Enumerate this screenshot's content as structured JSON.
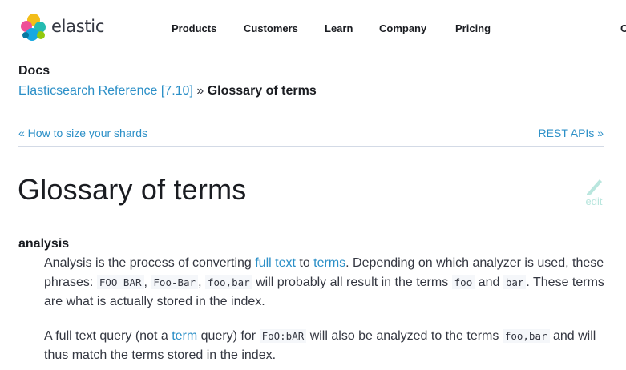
{
  "header": {
    "logo_text": "elastic",
    "nav": [
      "Products",
      "Customers",
      "Learn",
      "Company",
      "Pricing",
      "C"
    ]
  },
  "docs_label": "Docs",
  "breadcrumb": {
    "parent": "Elasticsearch Reference [7.10]",
    "separator": "»",
    "current": "Glossary of terms"
  },
  "pager": {
    "prev": "« How to size your shards",
    "next": "REST APIs »"
  },
  "page_title": "Glossary of terms",
  "edit_label": "edit",
  "term": {
    "name": "analysis",
    "p1": {
      "t1": "Analysis is the process of converting ",
      "link1": "full text",
      "t2": " to ",
      "link2": "terms",
      "t3": ". Depending on which analyzer is used, these phrases: ",
      "c1": "FOO BAR",
      "t4": ", ",
      "c2": "Foo-Bar",
      "t5": ", ",
      "c3": "foo,bar",
      "t6": " will probably all result in the terms ",
      "c4": "foo",
      "t7": " and ",
      "c5": "bar",
      "t8": ". These terms are what is actually stored in the index."
    },
    "p2": {
      "t1": "A full text query (not a ",
      "link1": "term",
      "t2": " query) for ",
      "c1": "FoO:bAR",
      "t3": " will also be analyzed to the terms ",
      "c2": "foo,bar",
      "t4": " and will thus match the terms stored in the index."
    }
  },
  "colors": {
    "link": "#2b8fc7",
    "text": "#343741",
    "edit": "#b9e6de"
  }
}
